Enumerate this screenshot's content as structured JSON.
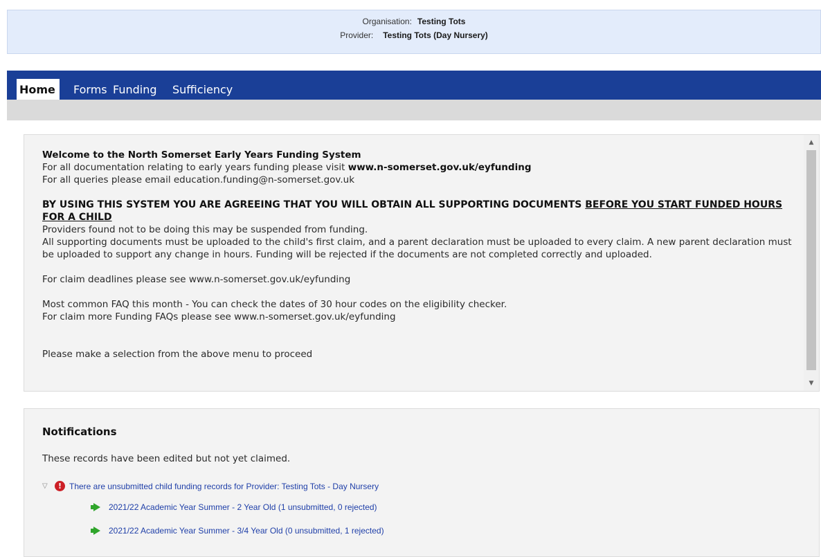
{
  "header": {
    "organisation_label": "Organisation:",
    "organisation_value": "Testing Tots",
    "provider_label": "Provider:",
    "provider_value": "Testing Tots (Day Nursery)"
  },
  "nav": {
    "items": [
      "Home",
      "Forms",
      "Funding",
      "Sufficiency"
    ],
    "active": "Home"
  },
  "welcome": {
    "title": "Welcome to the North Somerset Early Years Funding System",
    "doc_prefix": "For all documentation relating to early years funding please visit ",
    "doc_link": "www.n-somerset.gov.uk/eyfunding",
    "queries": "For all queries please email education.funding@n-somerset.gov.uk",
    "warning_main": "BY USING THIS SYSTEM YOU ARE AGREEING THAT YOU WILL OBTAIN ALL SUPPORTING DOCUMENTS ",
    "warning_underlined": "BEFORE YOU START FUNDED HOURS FOR A CHILD",
    "suspended": "Providers found not to be doing this may be suspended from funding.",
    "supporting_docs": "All supporting documents must be uploaded to the child's first claim, and a parent declaration must be uploaded to every claim. A new parent declaration must be uploaded to support any change in hours. Funding will be rejected if the documents are not completed correctly and uploaded.",
    "deadlines": "For claim deadlines please see www.n-somerset.gov.uk/eyfunding",
    "faq_month": "Most common FAQ this month - You can check the dates of 30 hour codes on the eligibility checker.",
    "faq_more": "For claim more Funding FAQs please see www.n-somerset.gov.uk/eyfunding",
    "proceed": "Please make a selection from the above menu to proceed"
  },
  "notifications": {
    "title": "Notifications",
    "description": "These records have been edited but not yet claimed.",
    "group": {
      "label": "There are unsubmitted child funding records for Provider: Testing Tots - Day Nursery",
      "items": [
        "2021/22 Academic Year Summer - 2 Year Old (1 unsubmitted, 0 rejected)",
        "2021/22 Academic Year Summer - 3/4 Year Old (0 unsubmitted, 1 rejected)"
      ]
    }
  },
  "colors": {
    "nav_bg": "#1a3f97",
    "header_bg": "#e3ecfb",
    "link": "#1f3fa8",
    "error": "#cc1f26",
    "arrow": "#2fa52b"
  }
}
